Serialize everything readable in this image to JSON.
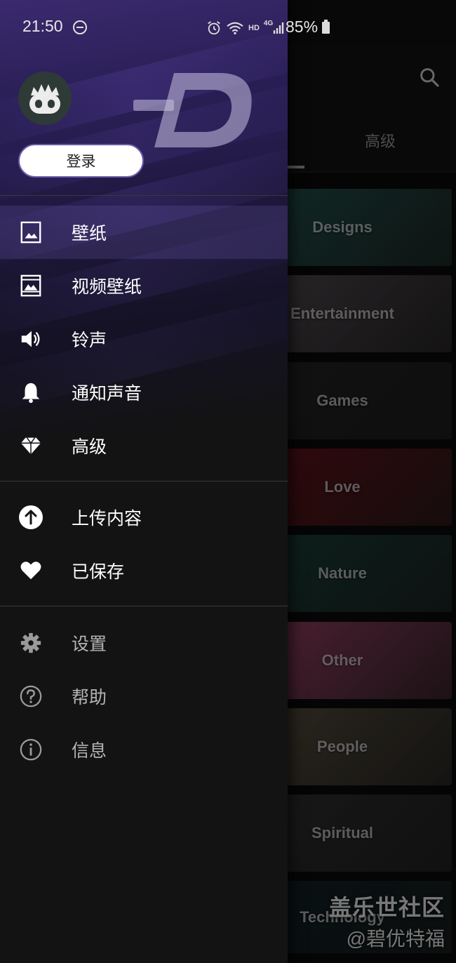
{
  "status_bar": {
    "time": "21:50",
    "network": "HD",
    "signal_type": "4G",
    "battery": "85%"
  },
  "background": {
    "tab_label": "高级",
    "categories": [
      {
        "label": "Designs",
        "color": "#1f4a45"
      },
      {
        "label": "Entertainment",
        "color": "#4a4348"
      },
      {
        "label": "Games",
        "color": "#202020"
      },
      {
        "label": "Love",
        "color": "#5a1016"
      },
      {
        "label": "Nature",
        "color": "#173a33"
      },
      {
        "label": "Other",
        "color": "#8a3a5a"
      },
      {
        "label": "People",
        "color": "#4e4638"
      },
      {
        "label": "Spiritual",
        "color": "#2c2c2c"
      },
      {
        "label": "Technology",
        "color": "#0d1f22"
      }
    ],
    "watermark_line1": "盖乐世社区",
    "watermark_line2": "@碧优特福"
  },
  "drawer": {
    "login_label": "登录",
    "primary_items": [
      {
        "label": "壁纸",
        "icon": "image-icon",
        "selected": true
      },
      {
        "label": "视频壁纸",
        "icon": "video-wallpaper-icon",
        "selected": false
      },
      {
        "label": "铃声",
        "icon": "speaker-icon",
        "selected": false
      },
      {
        "label": "通知声音",
        "icon": "bell-icon",
        "selected": false
      },
      {
        "label": "高级",
        "icon": "diamond-icon",
        "selected": false
      }
    ],
    "secondary_items": [
      {
        "label": "上传内容",
        "icon": "upload-icon"
      },
      {
        "label": "已保存",
        "icon": "heart-icon"
      }
    ],
    "tertiary_items": [
      {
        "label": "设置",
        "icon": "gear-icon"
      },
      {
        "label": "帮助",
        "icon": "help-icon"
      },
      {
        "label": "信息",
        "icon": "info-icon"
      }
    ]
  },
  "colors": {
    "accent_purple": "#3a2a6e",
    "drawer_bg": "#131313",
    "selected_bg": "#3b3260"
  }
}
